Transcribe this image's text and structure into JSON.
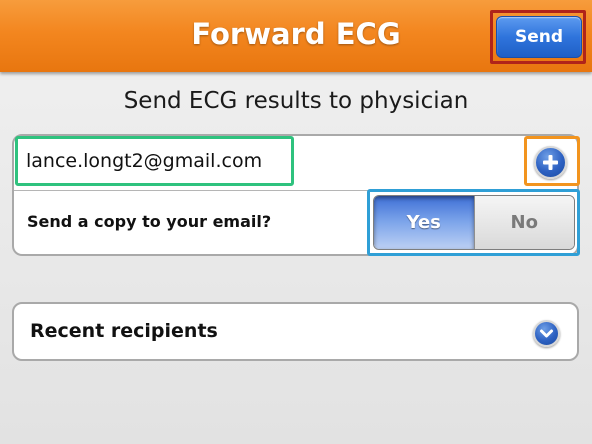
{
  "header": {
    "title": "Forward ECG",
    "send_label": "Send"
  },
  "main": {
    "subtitle": "Send ECG results to physician",
    "email_value": "lance.longt2@gmail.com",
    "add_icon": "plus-circle-icon",
    "copy_question": "Send a copy to your email?",
    "copy_toggle": {
      "options": [
        "Yes",
        "No"
      ],
      "selected": "Yes"
    },
    "recent_label": "Recent recipients",
    "recent_icon": "chevron-down-icon"
  },
  "colors": {
    "header_orange": "#f3861f",
    "button_blue": "#2f74dc",
    "send_outline_red": "#b0241a",
    "email_outline_green": "#2fc27e",
    "add_outline_orange": "#f2941e",
    "toggle_outline_blue": "#2f9fd6"
  }
}
